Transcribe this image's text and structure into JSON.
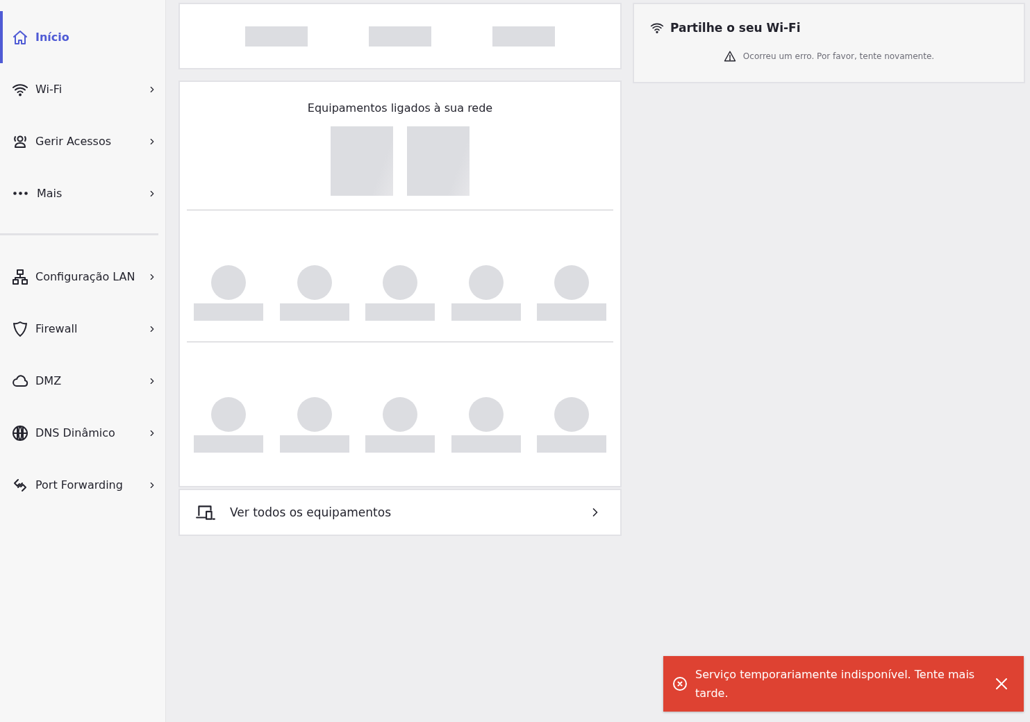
{
  "sidebar": {
    "groups": [
      {
        "items": [
          {
            "label": "Início",
            "selected": true,
            "chevron": false
          },
          {
            "label": "Wi-Fi",
            "selected": false,
            "chevron": true
          },
          {
            "label": "Gerir Acessos",
            "selected": false,
            "chevron": true
          },
          {
            "label": "Mais",
            "selected": false,
            "chevron": true
          }
        ]
      },
      {
        "items": [
          {
            "label": "Configuração LAN",
            "selected": false,
            "chevron": true
          },
          {
            "label": "Firewall",
            "selected": false,
            "chevron": true
          },
          {
            "label": "DMZ",
            "selected": false,
            "chevron": true
          },
          {
            "label": "DNS Dinâmico",
            "selected": false,
            "chevron": true
          },
          {
            "label": "Port Forwarding",
            "selected": false,
            "chevron": true
          }
        ]
      }
    ]
  },
  "devices_card": {
    "title": "Equipamentos ligados à sua rede"
  },
  "all_devices_link": {
    "label": "Ver todos os equipamentos"
  },
  "share_wifi_card": {
    "title": "Partilhe o seu Wi-Fi",
    "error": "Ocorreu um erro. Por favor, tente novamente."
  },
  "toast": {
    "message": "Serviço temporariamente indisponível. Tente mais tarde."
  }
}
